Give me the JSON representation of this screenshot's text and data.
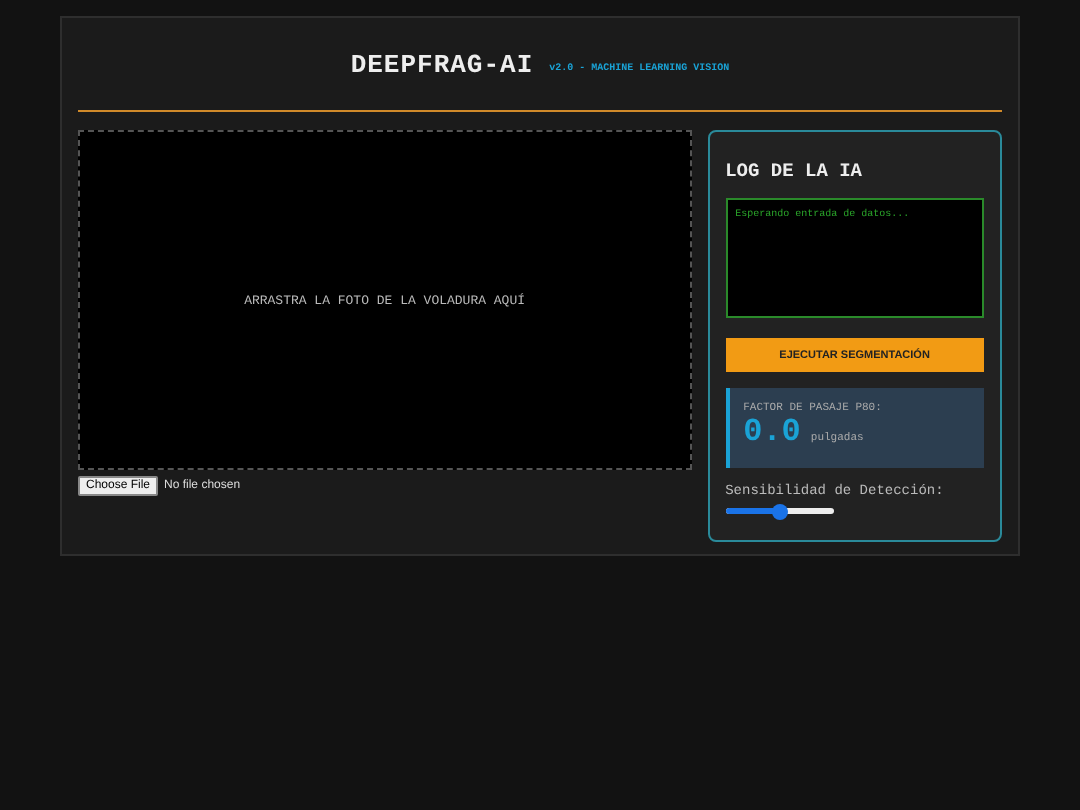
{
  "header": {
    "title": "DEEPFRAG-AI",
    "subtitle": "v2.0 - MACHINE LEARNING VISION"
  },
  "dropzone": {
    "label": "ARRASTRA LA FOTO DE LA VOLADURA AQUÍ"
  },
  "file_input": {
    "button": "Choose File",
    "status": "No file chosen"
  },
  "log_panel": {
    "title": "LOG DE LA IA",
    "log_placeholder": "Esperando entrada de datos...",
    "button": "EJECUTAR SEGMENTACIÓN",
    "result": {
      "label": "FACTOR DE PASAJE P80:",
      "value": "0.0",
      "unit": "pulgadas"
    },
    "slider": {
      "label": "Sensibilidad de Detección:",
      "level": 0.5
    }
  }
}
